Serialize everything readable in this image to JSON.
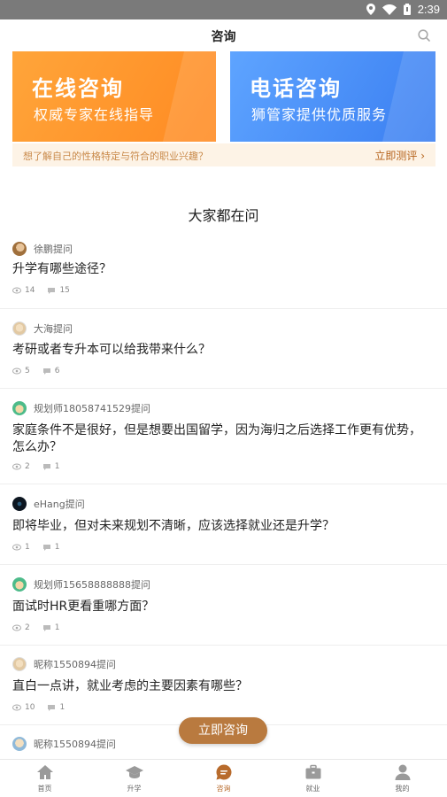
{
  "status_bar": {
    "time": "2:39"
  },
  "header": {
    "title": "咨询"
  },
  "banner": {
    "online": {
      "title": "在线咨询",
      "subtitle": "权威专家在线指导"
    },
    "phone": {
      "title": "电话咨询",
      "subtitle": "狮管家提供优质服务"
    },
    "test_prompt": "想了解自己的性格特定与符合的职业兴趣？",
    "test_link": "立即测评 ›"
  },
  "section_title": "大家都在问",
  "questions": [
    {
      "user": "徐鹏提问",
      "text": "升学有哪些途径？",
      "views": "14",
      "comments": "15"
    },
    {
      "user": "大海提问",
      "text": "考研或者专升本可以给我带来什么？",
      "views": "5",
      "comments": "6"
    },
    {
      "user": "规划师18058741529提问",
      "text": "家庭条件不是很好，但是想要出国留学，因为海归之后选择工作更有优势，怎么办？",
      "views": "2",
      "comments": "1"
    },
    {
      "user": "eHang提问",
      "text": "即将毕业，但对未来规划不清晰，应该选择就业还是升学？",
      "views": "1",
      "comments": "1"
    },
    {
      "user": "规划师15658888888提问",
      "text": "面试时HR更看重哪方面？",
      "views": "2",
      "comments": "1"
    },
    {
      "user": "昵称1550894提问",
      "text": "直白一点讲，就业考虑的主要因素有哪些？",
      "views": "10",
      "comments": "1"
    },
    {
      "user": "昵称1550894提问"
    }
  ],
  "consult_button": "立即咨询",
  "tabs": [
    {
      "label": "首页",
      "icon": "home-icon"
    },
    {
      "label": "升学",
      "icon": "graduation-cap-icon"
    },
    {
      "label": "咨询",
      "icon": "chat-icon",
      "active": true
    },
    {
      "label": "就业",
      "icon": "briefcase-icon"
    },
    {
      "label": "我的",
      "icon": "person-icon"
    }
  ],
  "colors": {
    "accent": "#b86b2c",
    "online_card": "#ff9a2e",
    "phone_card": "#4a8cf7",
    "button": "#b97a3f"
  }
}
